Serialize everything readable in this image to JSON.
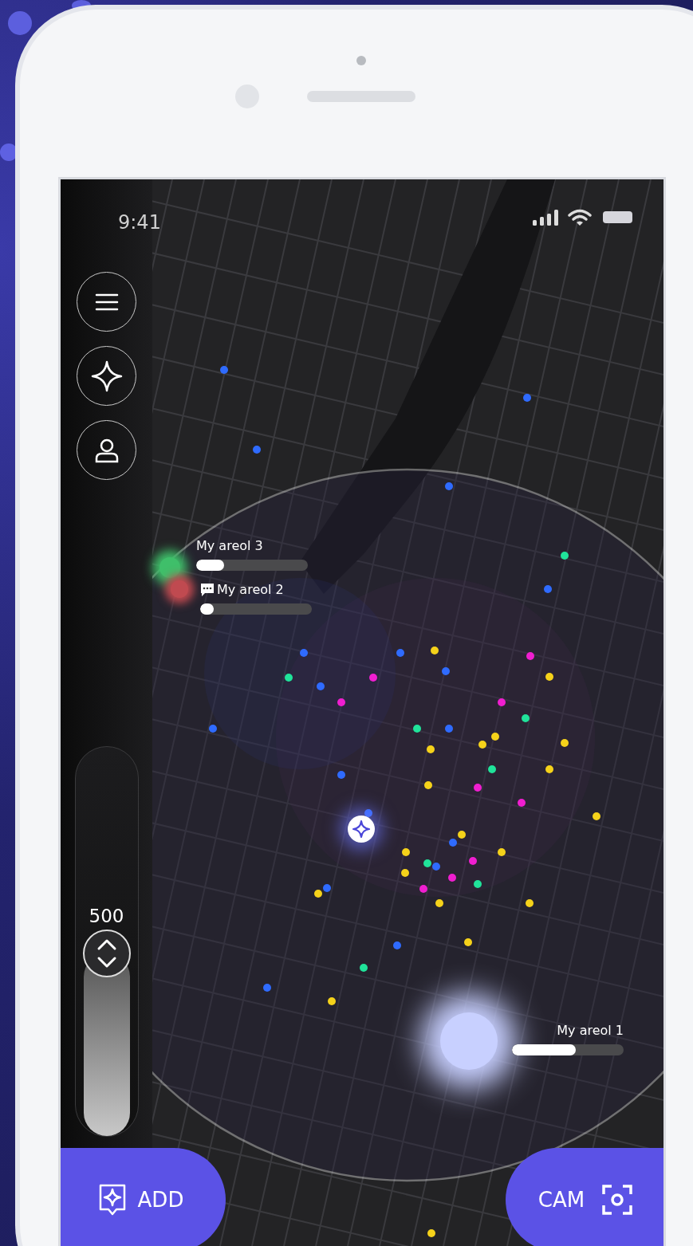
{
  "status_bar": {
    "time": "9:41"
  },
  "sidebar": {
    "buttons": [
      {
        "kind": "menu"
      },
      {
        "kind": "star"
      },
      {
        "kind": "profile"
      }
    ]
  },
  "radius_slider": {
    "value": "500",
    "level": 0.47
  },
  "areas": [
    {
      "label": "My areol 3",
      "level": 0.25,
      "has_message": false,
      "color": "#3fbf6a"
    },
    {
      "label": "My areol 2",
      "level": 0.12,
      "has_message": true,
      "color": "#c04a50"
    },
    {
      "label": "My areol 1",
      "level": 0.57,
      "has_message": false,
      "color": "#c8d0ff"
    }
  ],
  "actions": [
    {
      "kind": "add",
      "label": "ADD"
    },
    {
      "kind": "cam",
      "label": "CAM"
    }
  ]
}
